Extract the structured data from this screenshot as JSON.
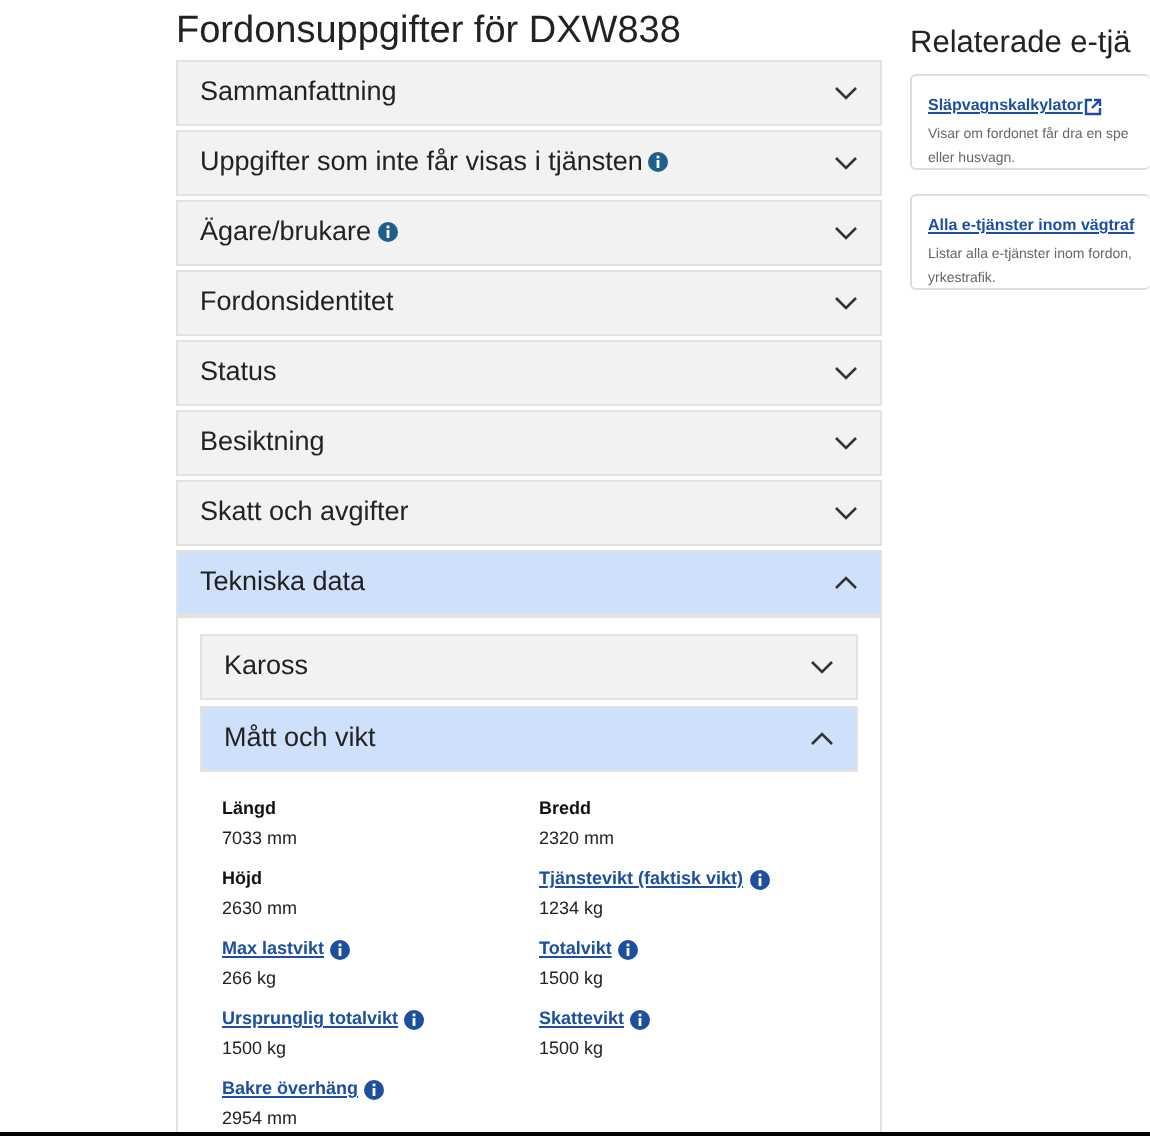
{
  "title": "Fordonsuppgifter för DXW838",
  "sections": [
    {
      "label": "Sammanfattning",
      "info": false,
      "expanded": false
    },
    {
      "label": "Uppgifter som inte får visas i tjänsten",
      "info": true,
      "expanded": false
    },
    {
      "label": "Ägare/brukare",
      "info": true,
      "expanded": false
    },
    {
      "label": "Fordonsidentitet",
      "info": false,
      "expanded": false
    },
    {
      "label": "Status",
      "info": false,
      "expanded": false
    },
    {
      "label": "Besiktning",
      "info": false,
      "expanded": false
    },
    {
      "label": "Skatt och avgifter",
      "info": false,
      "expanded": false
    },
    {
      "label": "Tekniska data",
      "info": false,
      "expanded": true,
      "subsections": [
        {
          "label": "Kaross",
          "expanded": false
        },
        {
          "label": "Mått och vikt",
          "expanded": true,
          "fields": [
            {
              "label": "Längd",
              "link": false,
              "value": "7033 mm"
            },
            {
              "label": "Bredd",
              "link": false,
              "value": "2320 mm"
            },
            {
              "label": "Höjd",
              "link": false,
              "value": "2630 mm"
            },
            {
              "label": "Tjänstevikt (faktisk vikt)",
              "link": true,
              "value": "1234 kg"
            },
            {
              "label": "Max lastvikt",
              "link": true,
              "value": "266 kg"
            },
            {
              "label": "Totalvikt",
              "link": true,
              "value": "1500 kg"
            },
            {
              "label": "Ursprunglig totalvikt",
              "link": true,
              "value": "1500 kg"
            },
            {
              "label": "Skattevikt",
              "link": true,
              "value": "1500 kg"
            },
            {
              "label": "Bakre överhäng",
              "link": true,
              "value": "2954 mm"
            }
          ]
        }
      ]
    }
  ],
  "related": {
    "title": "Relaterade e-tjä",
    "cards": [
      {
        "link": "Släpvagnskalkylator",
        "external": true,
        "description": "Visar om fordonet får dra en spe",
        "description_2": "eller husvagn."
      },
      {
        "link": "Alla e-tjänster inom vägtraf",
        "external": false,
        "description": "Listar alla e-tjänster inom fordon,",
        "description_2": "yrkestrafik."
      }
    ]
  }
}
